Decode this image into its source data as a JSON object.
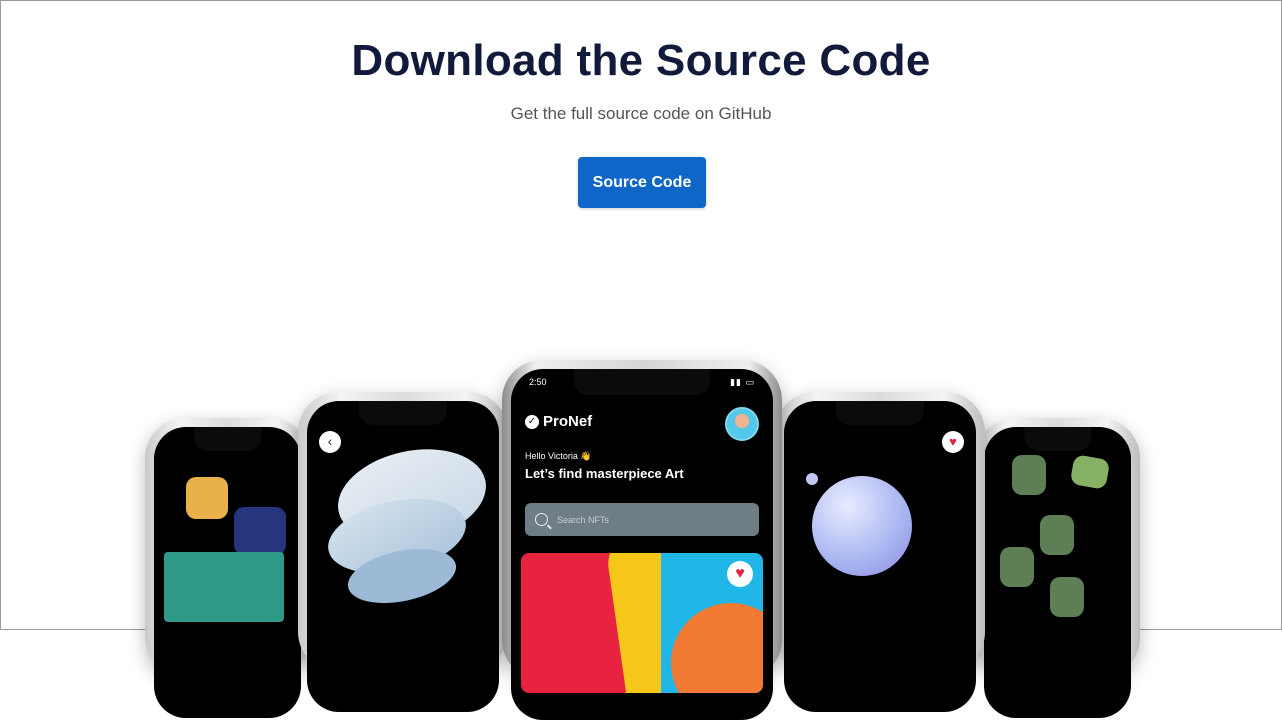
{
  "section": {
    "title": "Download the Source Code",
    "subtitle": "Get the full source code on GitHub",
    "button_label": "Source Code"
  },
  "app": {
    "time": "2:50",
    "logo_text": "ProNef",
    "greeting": "Hello Victoria 👋",
    "headline": "Let’s find masterpiece Art",
    "search_placeholder": "Search NFTs"
  },
  "colors": {
    "title": "#111a3a",
    "button": "#0f66c8",
    "app_background": "#0d2331",
    "heart": "#e02441"
  },
  "icons": {
    "heart": "heart-icon",
    "search": "search-icon",
    "back": "chevron-left-icon",
    "logo": "check-circle-icon"
  }
}
